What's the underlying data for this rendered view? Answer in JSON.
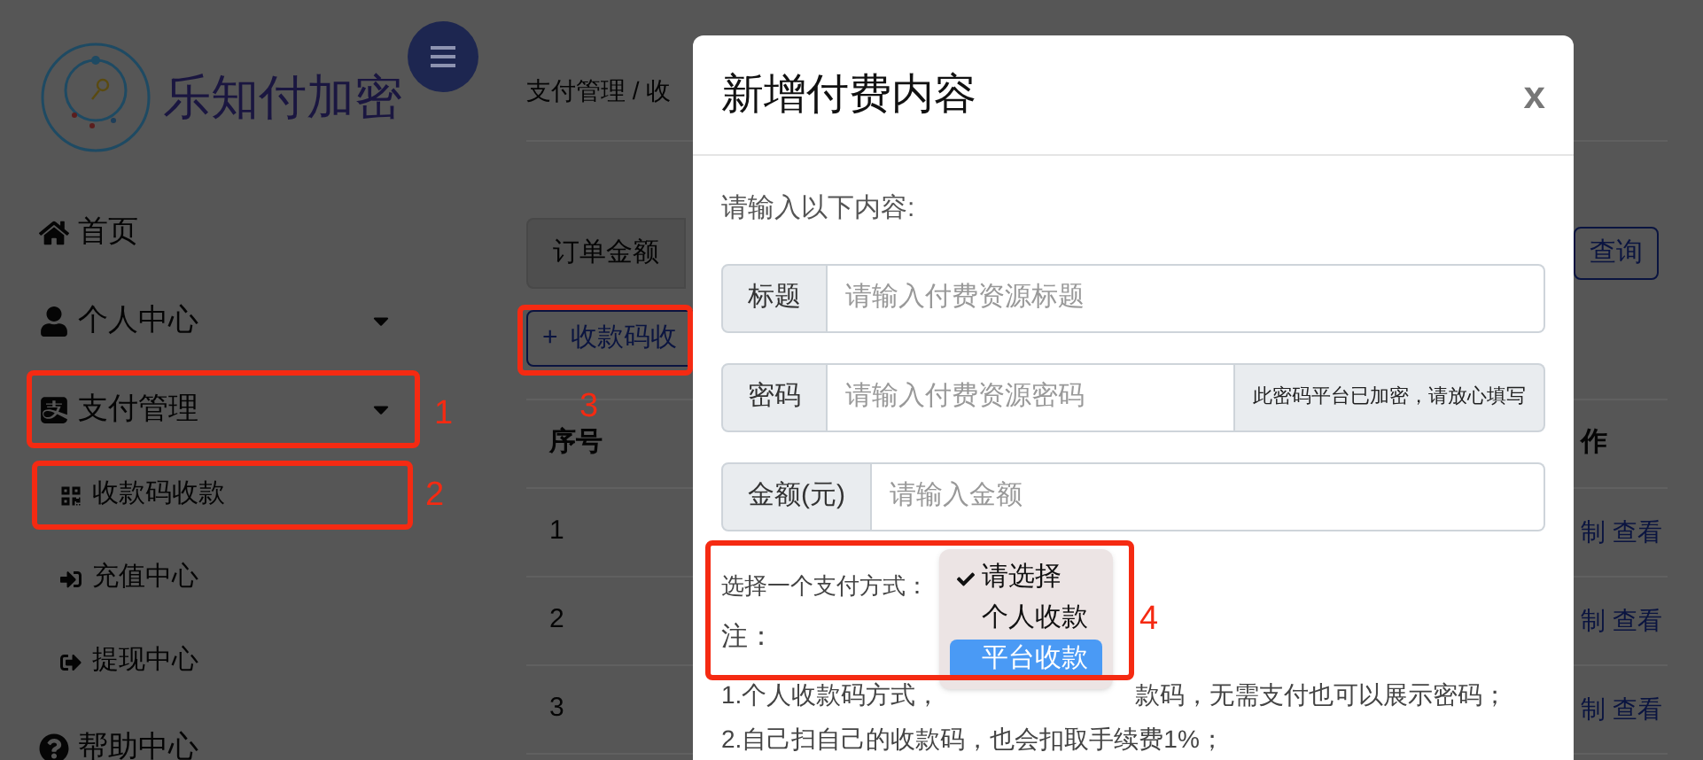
{
  "sidebar": {
    "logo_text": "乐知付加密",
    "items": [
      {
        "label": "首页",
        "expandable": false
      },
      {
        "label": "个人中心",
        "expandable": true
      },
      {
        "label": "支付管理",
        "expandable": true,
        "expanded": true,
        "children": [
          {
            "label": "收款码收款"
          },
          {
            "label": "充值中心"
          },
          {
            "label": "提现中心"
          }
        ]
      },
      {
        "label": "帮助中心",
        "expandable": false
      }
    ]
  },
  "main": {
    "breadcrumb": "支付管理 / 收",
    "filter": {
      "addon": "订单金额",
      "search_button": "查询"
    },
    "add_button": {
      "icon_text": "+",
      "label": "收款码收"
    },
    "table": {
      "columns": [
        "序号",
        "作"
      ],
      "rows": [
        {
          "index": "1",
          "actions": [
            "制",
            "查看"
          ]
        },
        {
          "index": "2",
          "actions": [
            "制",
            "查看"
          ]
        },
        {
          "index": "3",
          "actions": [
            "制",
            "查看"
          ]
        }
      ]
    }
  },
  "modal": {
    "title": "新增付费内容",
    "close": "x",
    "intro": "请输入以下内容:",
    "fields": [
      {
        "label": "标题",
        "placeholder": "请输入付费资源标题"
      },
      {
        "label": "密码",
        "placeholder": "请输入付费资源密码",
        "addon": "此密码平台已加密，请放心填写"
      },
      {
        "label": "金额(元)",
        "placeholder": "请输入金额"
      }
    ],
    "select": {
      "label": "选择一个支付方式：",
      "options": [
        {
          "label": "请选择",
          "checked": true,
          "selected": false
        },
        {
          "label": "个人收款",
          "checked": false,
          "selected": false
        },
        {
          "label": "平台收款",
          "checked": false,
          "selected": true
        }
      ]
    },
    "notes": {
      "heading": "注：",
      "lines": [
        {
          "parts": [
            "1.个人收款码方式，",
            "款码，无需支付也可以展示密码；"
          ]
        },
        {
          "parts": [
            "2.自己扫自己的收款码，也会扣取手续费1%；"
          ]
        }
      ]
    }
  },
  "annotations": [
    {
      "label": "1"
    },
    {
      "label": "2"
    },
    {
      "label": "3"
    },
    {
      "label": "4"
    }
  ]
}
